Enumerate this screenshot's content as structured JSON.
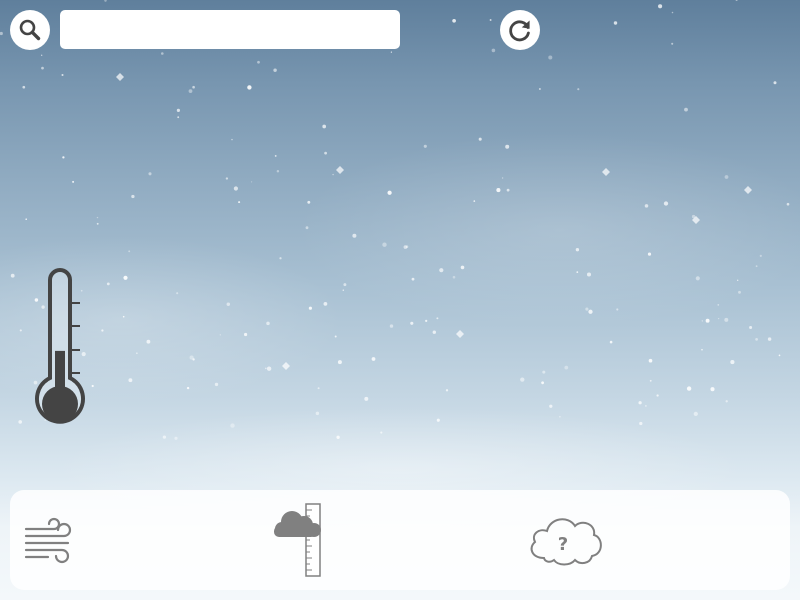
{
  "app": {
    "title": ""
  },
  "header": {
    "search_button_icon": "search-icon",
    "search_input": {
      "value": "",
      "placeholder": ""
    },
    "refresh_button_icon": "refresh-icon"
  },
  "main": {
    "temperature_icon": "thermometer-icon",
    "temperature_level": 0.45
  },
  "bottom_panel": {
    "items": [
      {
        "icon": "wind-icon"
      },
      {
        "icon": "cloud-precipitation-gauge-icon"
      },
      {
        "icon": "cloud-question-icon"
      }
    ]
  },
  "colors": {
    "icon_dark": "#444444",
    "icon_gray": "#808080",
    "panel_background": "#ffffff",
    "button_background": "#ffffff",
    "sky_top": "#5f7f9c",
    "sky_bottom": "#f4f8fb"
  }
}
